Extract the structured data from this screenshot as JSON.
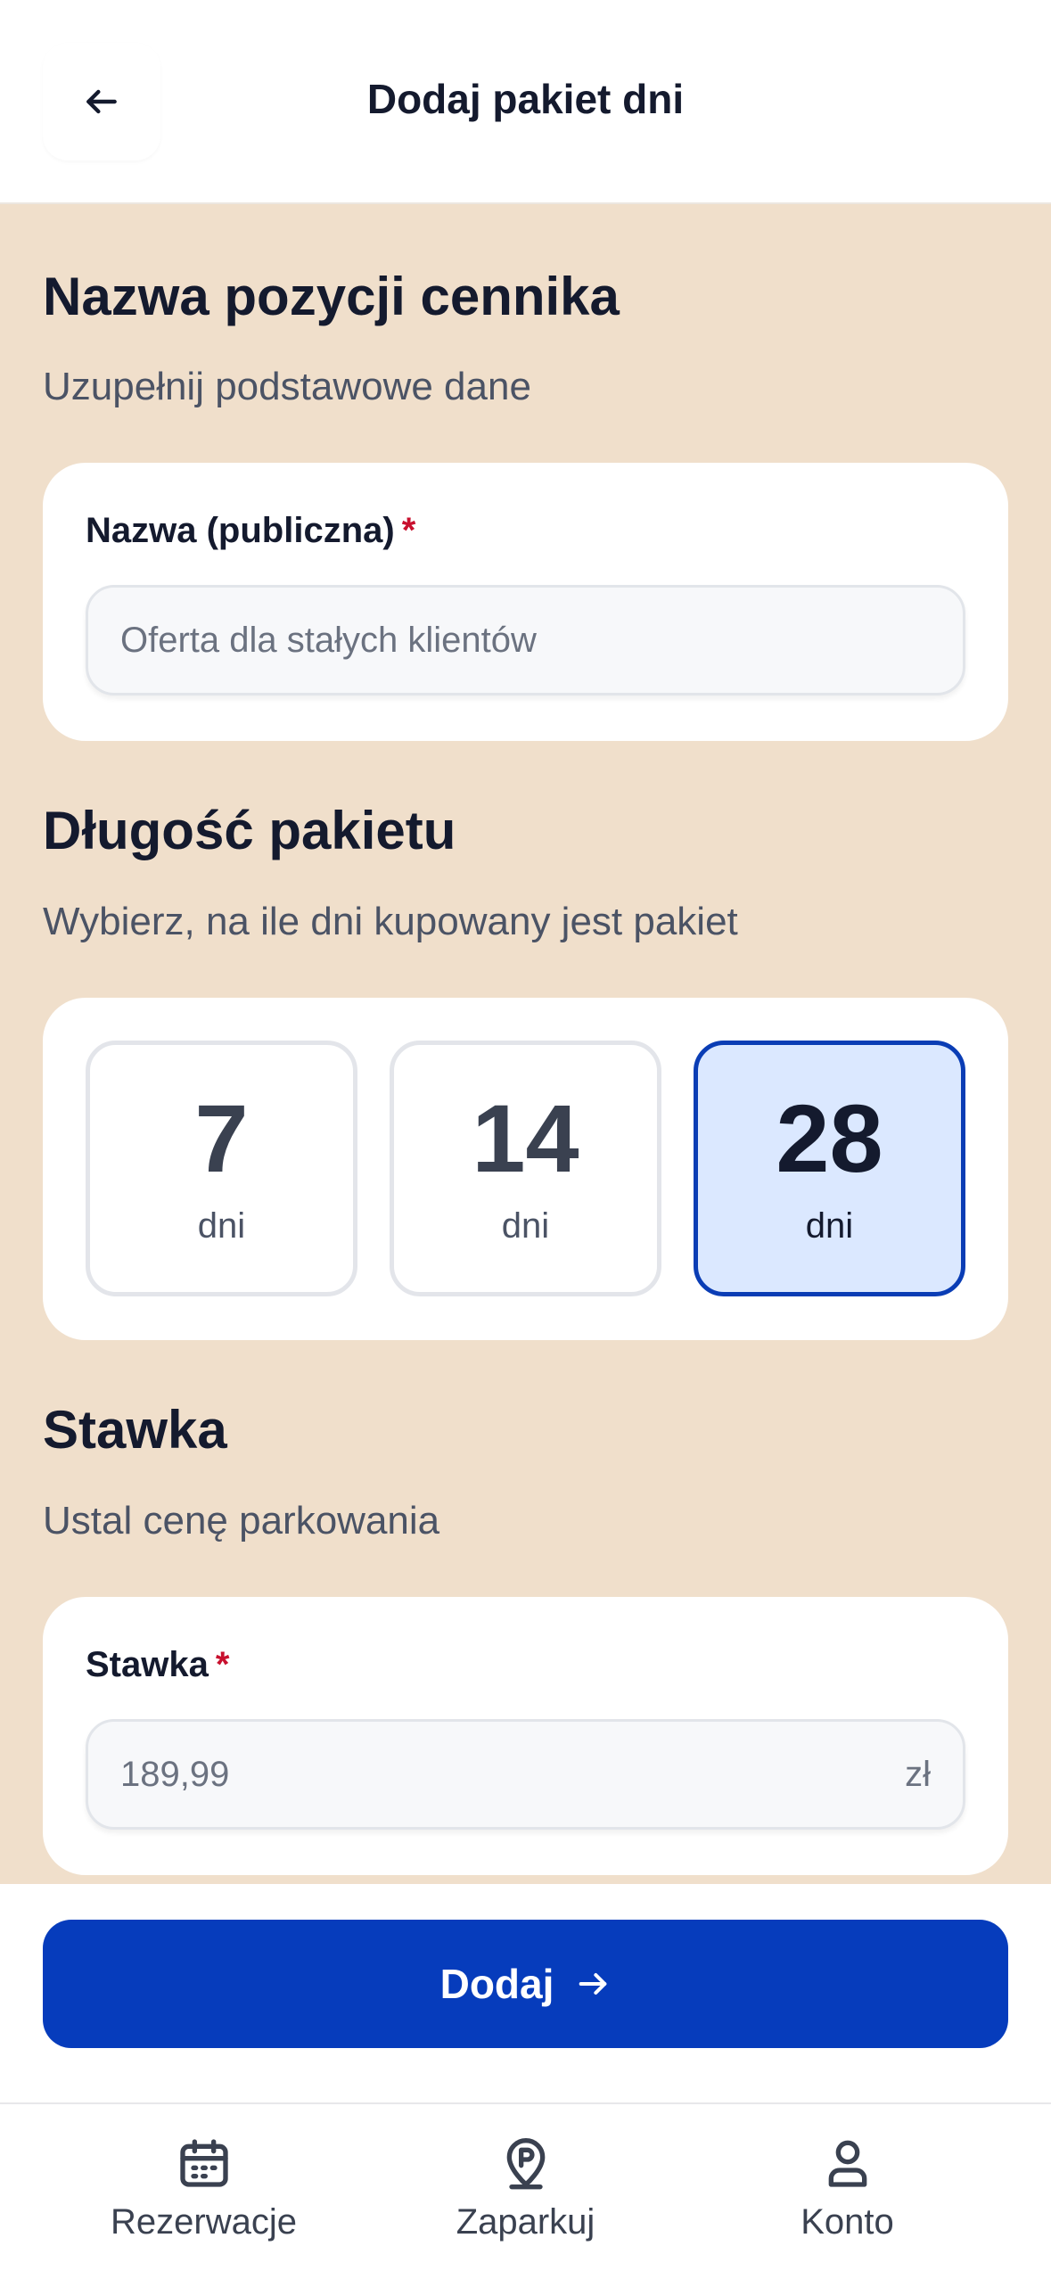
{
  "header": {
    "title": "Dodaj pakiet dni",
    "back_icon": "arrow-left-icon"
  },
  "sections": {
    "name": {
      "title": "Nazwa pozycji cennika",
      "subtitle": "Uzupełnij podstawowe dane",
      "field_label": "Nazwa (publiczna)",
      "required_mark": "*",
      "placeholder": "Oferta dla stałych klientów"
    },
    "length": {
      "title": "Długość pakietu",
      "subtitle": "Wybierz, na ile dni kupowany jest pakiet",
      "options": [
        {
          "value": "7",
          "unit": "dni",
          "selected": false
        },
        {
          "value": "14",
          "unit": "dni",
          "selected": false
        },
        {
          "value": "28",
          "unit": "dni",
          "selected": true
        }
      ]
    },
    "rate": {
      "title": "Stawka",
      "subtitle": "Ustal cenę parkowania",
      "field_label": "Stawka",
      "required_mark": "*",
      "placeholder": "189,99",
      "currency": "zł"
    }
  },
  "action": {
    "label": "Dodaj",
    "icon": "arrow-right-icon"
  },
  "bottom_nav": {
    "items": [
      {
        "label": "Rezerwacje",
        "icon": "calendar-icon"
      },
      {
        "label": "Zaparkuj",
        "icon": "parking-pin-icon"
      },
      {
        "label": "Konto",
        "icon": "user-icon"
      }
    ]
  },
  "colors": {
    "background": "#f0dfcb",
    "primary": "#063cbc",
    "selected_fill": "#dbe8ff",
    "required": "#c8102e"
  }
}
